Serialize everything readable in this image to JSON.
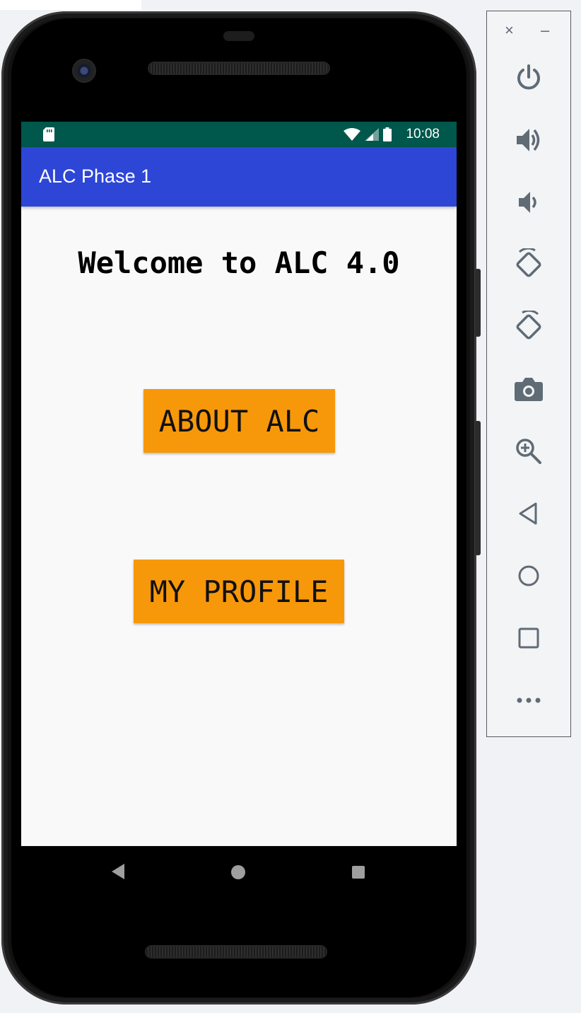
{
  "status_bar": {
    "time": "10:08"
  },
  "app_bar": {
    "title": "ALC Phase 1"
  },
  "content": {
    "welcome_text": "Welcome to ALC 4.0",
    "about_button": "ABOUT ALC",
    "profile_button": "MY PROFILE"
  },
  "emulator_toolbar": {
    "close_glyph": "×",
    "minimize_glyph": "–",
    "buttons": [
      "power-icon",
      "volume-up-icon",
      "volume-down-icon",
      "rotate-left-icon",
      "rotate-right-icon",
      "camera-icon",
      "zoom-icon",
      "back-icon",
      "home-icon",
      "overview-icon",
      "more-icon"
    ]
  },
  "colors": {
    "status_bar": "#00574b",
    "app_bar": "#2d46d6",
    "button": "#f7980a",
    "screen_bg": "#f9f9f9",
    "toolbar_icon": "#5f6b75"
  }
}
